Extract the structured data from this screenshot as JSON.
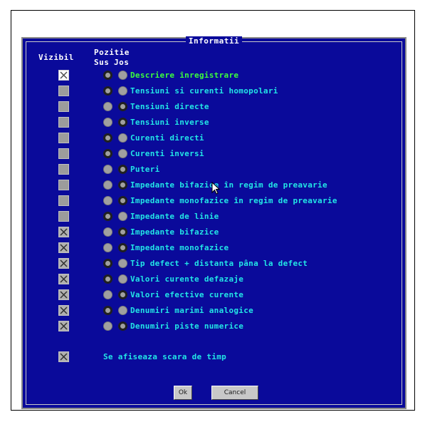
{
  "dialog": {
    "title": "Informatii",
    "headers": {
      "visible": "Vizibil",
      "position": "Pozitie",
      "up": "Sus",
      "down": "Jos"
    },
    "rows": [
      {
        "label": "Descriere înregistrare",
        "visible": true,
        "position": "sus"
      },
      {
        "label": "Tensiuni si curenti homopolari",
        "visible": false,
        "position": "sus"
      },
      {
        "label": "Tensiuni directe",
        "visible": false,
        "position": "jos"
      },
      {
        "label": "Tensiuni inverse",
        "visible": false,
        "position": "jos"
      },
      {
        "label": "Curenti directi",
        "visible": false,
        "position": "sus"
      },
      {
        "label": "Curenti inversi",
        "visible": false,
        "position": "sus"
      },
      {
        "label": "Puteri",
        "visible": false,
        "position": "jos"
      },
      {
        "label": "Impedante bifazice în regim de preavarie",
        "visible": false,
        "position": "jos"
      },
      {
        "label": "Impedante monofazice în regim de preavarie",
        "visible": false,
        "position": "jos"
      },
      {
        "label": "Impedante de linie",
        "visible": false,
        "position": "sus"
      },
      {
        "label": "Impedante bifazice",
        "visible": true,
        "position": "jos"
      },
      {
        "label": "Impedante monofazice",
        "visible": true,
        "position": "jos"
      },
      {
        "label": "Tip defect + distanta pâna la defect",
        "visible": true,
        "position": "sus"
      },
      {
        "label": "Valori curente defazaje",
        "visible": true,
        "position": "sus"
      },
      {
        "label": "Valori efective curente",
        "visible": true,
        "position": "jos"
      },
      {
        "label": "Denumiri marimi analogice",
        "visible": true,
        "position": "sus"
      },
      {
        "label": "Denumiri piste numerice",
        "visible": true,
        "position": "jos"
      }
    ],
    "timescale": {
      "label": "Se afiseaza scara de timp",
      "visible": true
    },
    "buttons": {
      "ok": "Ok",
      "cancel": "Cancel"
    }
  },
  "colors": {
    "background": "#0a0a9a",
    "label": "#22e6e6",
    "first_label": "#3cff3c",
    "header": "#ffffff"
  }
}
